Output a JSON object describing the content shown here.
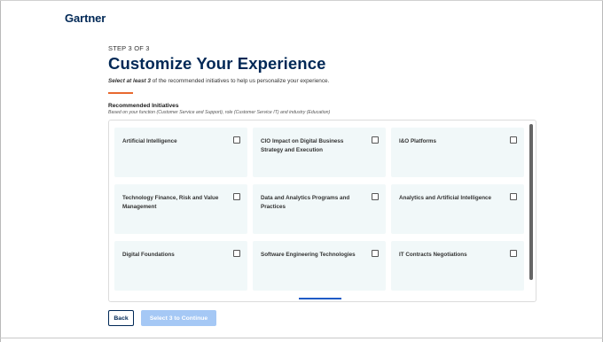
{
  "brand": {
    "logo_text": "Gartner"
  },
  "step": {
    "label": "STEP 3 OF 3"
  },
  "page": {
    "title": "Customize Your Experience",
    "subtitle_emphasis": "Select at least 3",
    "subtitle_rest": " of the recommended initiatives to help us personalize your experience."
  },
  "recommended": {
    "heading": "Recommended Initiatives",
    "basis": "Based on your function (Customer Service and Support), role (Customer Service IT) and industry (Education)",
    "initiatives": [
      {
        "label": "Artificial Intelligence",
        "checked": false
      },
      {
        "label": "CIO Impact on Digital Business Strategy and Execution",
        "checked": false
      },
      {
        "label": "I&O Platforms",
        "checked": false
      },
      {
        "label": "Technology Finance, Risk and Value Management",
        "checked": false
      },
      {
        "label": "Data and Analytics Programs and Practices",
        "checked": false
      },
      {
        "label": "Analytics and Artificial Intelligence",
        "checked": false
      },
      {
        "label": "Digital Foundations",
        "checked": false
      },
      {
        "label": "Software Engineering Technologies",
        "checked": false
      },
      {
        "label": "IT Contracts Negotiations",
        "checked": false
      }
    ]
  },
  "actions": {
    "back_label": "Back",
    "continue_label": "Select 3 to Continue"
  },
  "colors": {
    "brand_navy": "#002856",
    "accent_orange": "#e8692f",
    "card_bg": "#f1f8f9",
    "disabled_button": "#a5c8f5"
  }
}
